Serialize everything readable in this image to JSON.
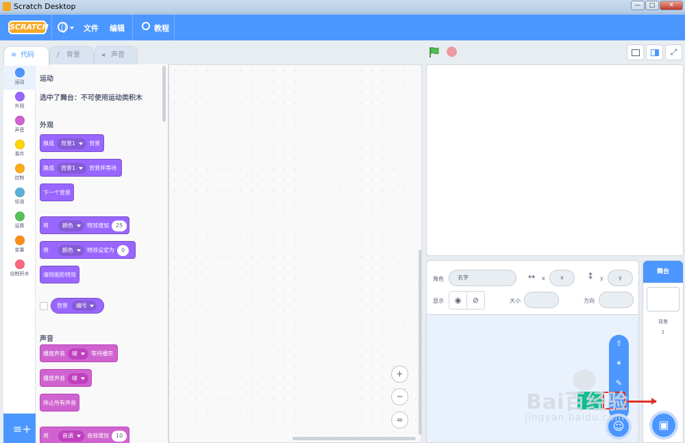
{
  "window": {
    "title": "Scratch Desktop",
    "minimize": "—",
    "maximize": "□",
    "close": "✕"
  },
  "menubar": {
    "logo": "SCRATCH",
    "file": "文件",
    "edit": "编辑",
    "tutorials": "教程"
  },
  "tabs": [
    {
      "label": "代码",
      "icon": "code-icon",
      "active": true
    },
    {
      "label": "背景",
      "icon": "brush-icon",
      "active": false
    },
    {
      "label": "声音",
      "icon": "speaker-icon",
      "active": false
    }
  ],
  "categories": [
    {
      "label": "运动",
      "color": "#4c97ff"
    },
    {
      "label": "外观",
      "color": "#9966ff"
    },
    {
      "label": "声音",
      "color": "#cf63cf"
    },
    {
      "label": "事件",
      "color": "#ffd500"
    },
    {
      "label": "控制",
      "color": "#ffab19"
    },
    {
      "label": "侦测",
      "color": "#5cb1d6"
    },
    {
      "label": "运算",
      "color": "#59c059"
    },
    {
      "label": "变量",
      "color": "#ff8c1a"
    },
    {
      "label": "自制积木",
      "color": "#ff6680"
    }
  ],
  "palette": {
    "motion_title": "运动",
    "motion_note": "选中了舞台：不可使用运动类积木",
    "looks_title": "外观",
    "blocks": {
      "switch_backdrop": {
        "pre": "换成",
        "dd": "背景1",
        "post": "背景"
      },
      "switch_backdrop_wait": {
        "pre": "换成",
        "dd": "背景1",
        "post": "背景并等待"
      },
      "next_backdrop": {
        "pre": "下一个背景"
      },
      "change_effect": {
        "pre": "将",
        "dd": "颜色",
        "post": "特效增加",
        "num": "25"
      },
      "set_effect": {
        "pre": "将",
        "dd": "颜色",
        "post": "特效设定为",
        "num": "0"
      },
      "clear_effects": {
        "pre": "清除图形特效"
      },
      "backdrop_reporter": {
        "pre": "背景",
        "dd": "编号"
      }
    },
    "sound_title": "声音",
    "sound_blocks": {
      "play_until_done": {
        "pre": "播放声音",
        "dd": "啵",
        "post": "等待播完"
      },
      "start_sound": {
        "pre": "播放声音",
        "dd": "啵"
      },
      "stop_all": {
        "pre": "停止所有声音"
      },
      "change_sound_effect": {
        "pre": "将",
        "dd": "音调",
        "post": "音效增加",
        "num": "10"
      }
    }
  },
  "zoom": {
    "in": "+",
    "out": "−",
    "reset": "="
  },
  "sprite_info": {
    "sprite_label": "角色",
    "name_placeholder": "名字",
    "x_label": "x",
    "x_placeholder": "x",
    "y_label": "y",
    "y_placeholder": "y",
    "show_label": "显示",
    "size_label": "大小",
    "direction_label": "方向"
  },
  "stage_panel": {
    "title": "舞台",
    "backdrops_label": "背景",
    "backdrops_count": "1"
  },
  "watermark": {
    "text": "Bai百经验",
    "url": "jingyan.baidu.com"
  },
  "colors": {
    "accent": "#4c97ff",
    "looks": "#9966ff",
    "sound": "#cf63cf"
  }
}
